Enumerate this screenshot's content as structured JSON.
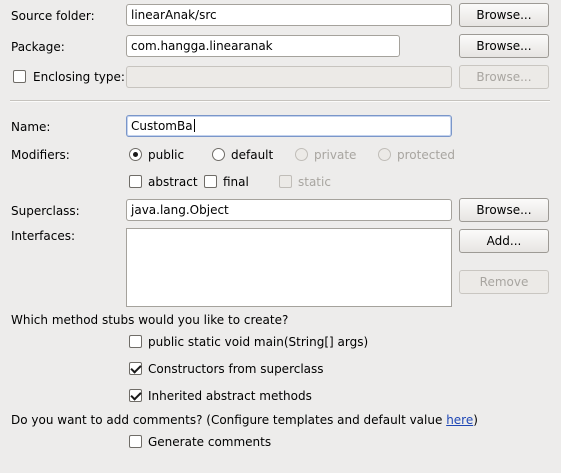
{
  "source_folder": {
    "label": "Source folder:",
    "value": "linearAnak/src",
    "browse": "Browse..."
  },
  "package": {
    "label": "Package:",
    "value": "com.hangga.linearanak",
    "browse": "Browse..."
  },
  "enclosing_type": {
    "label": "Enclosing type:",
    "value": "",
    "browse": "Browse...",
    "checked": false,
    "enabled": false
  },
  "name": {
    "label": "Name:",
    "value": "CustomBa"
  },
  "modifiers": {
    "label": "Modifiers:",
    "access": [
      {
        "label": "public",
        "selected": true,
        "enabled": true
      },
      {
        "label": "default",
        "selected": false,
        "enabled": true
      },
      {
        "label": "private",
        "selected": false,
        "enabled": false
      },
      {
        "label": "protected",
        "selected": false,
        "enabled": false
      }
    ],
    "other": [
      {
        "label": "abstract",
        "checked": false,
        "enabled": true
      },
      {
        "label": "final",
        "checked": false,
        "enabled": true
      },
      {
        "label": "static",
        "checked": false,
        "enabled": false
      }
    ]
  },
  "superclass": {
    "label": "Superclass:",
    "value": "java.lang.Object",
    "browse": "Browse..."
  },
  "interfaces": {
    "label": "Interfaces:",
    "add": "Add...",
    "remove": "Remove",
    "items": []
  },
  "method_stubs": {
    "question": "Which method stubs would you like to create?",
    "options": [
      {
        "label": "public static void main(String[] args)",
        "checked": false
      },
      {
        "label": "Constructors from superclass",
        "checked": true
      },
      {
        "label": "Inherited abstract methods",
        "checked": true
      }
    ]
  },
  "comments": {
    "question_prefix": "Do you want to add comments? (Configure templates and default value ",
    "link": "here",
    "question_suffix": ")",
    "option": {
      "label": "Generate comments",
      "checked": false
    }
  }
}
